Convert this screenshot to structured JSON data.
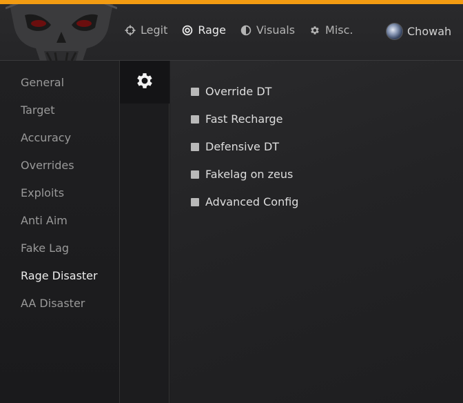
{
  "theme": {
    "accent": "#f39c12",
    "background": "#1d1d1f"
  },
  "header": {
    "nav": [
      {
        "label": "Legit",
        "icon": "crosshair-icon"
      },
      {
        "label": "Rage",
        "icon": "target-icon",
        "active": true
      },
      {
        "label": "Visuals",
        "icon": "half-circle-icon"
      },
      {
        "label": "Misc.",
        "icon": "gear-icon"
      }
    ],
    "user": {
      "name": "Chowah",
      "icon": "avatar"
    }
  },
  "sidebar": {
    "items": [
      {
        "label": "General"
      },
      {
        "label": "Target"
      },
      {
        "label": "Accuracy"
      },
      {
        "label": "Overrides"
      },
      {
        "label": "Exploits"
      },
      {
        "label": "Anti Aim"
      },
      {
        "label": "Fake Lag"
      },
      {
        "label": "Rage Disaster",
        "active": true
      },
      {
        "label": "AA Disaster"
      }
    ]
  },
  "subnav": {
    "icon": "gear-icon"
  },
  "content": {
    "options": [
      {
        "label": "Override DT",
        "checked": false
      },
      {
        "label": "Fast Recharge",
        "checked": false
      },
      {
        "label": "Defensive DT",
        "checked": false
      },
      {
        "label": "Fakelag on zeus",
        "checked": false
      },
      {
        "label": "Advanced Config",
        "checked": false
      }
    ]
  }
}
